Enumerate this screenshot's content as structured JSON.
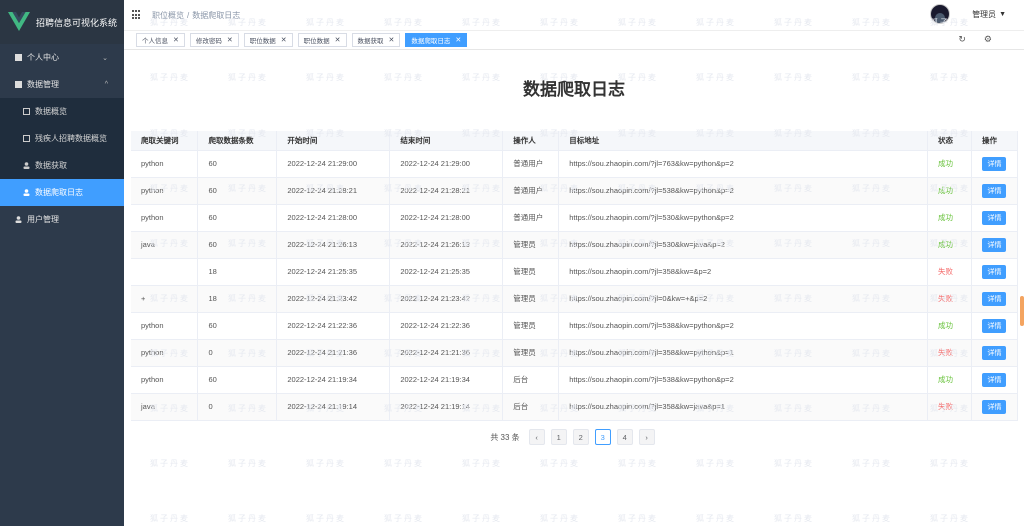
{
  "app": {
    "title": "招聘信息可视化系统"
  },
  "sidebar": {
    "items": [
      {
        "label": "个人中心",
        "icon": "square-icon"
      },
      {
        "label": "数据管理",
        "icon": "square-icon"
      }
    ],
    "sub_items": [
      {
        "label": "数据概览",
        "icon": "doc-icon"
      },
      {
        "label": "残疾人招聘数据概览",
        "icon": "doc-icon"
      },
      {
        "label": "数据获取",
        "icon": "user-icon"
      },
      {
        "label": "数据爬取日志",
        "icon": "user-icon"
      }
    ],
    "bottom_item": {
      "label": "用户管理",
      "icon": "user-icon"
    }
  },
  "header": {
    "breadcrumb": [
      "职位概览",
      "数据爬取日志"
    ],
    "user_name": "管理员"
  },
  "tags": [
    {
      "label": "个人信息"
    },
    {
      "label": "修改密码"
    },
    {
      "label": "职位数据"
    },
    {
      "label": "职位数据"
    },
    {
      "label": "数据获取"
    },
    {
      "label": "数据爬取日志"
    }
  ],
  "page": {
    "title": "数据爬取日志"
  },
  "table": {
    "headers": [
      "爬取关键词",
      "爬取数据条数",
      "开始时间",
      "结束时间",
      "操作人",
      "目标地址",
      "状态",
      "操作"
    ],
    "detail_label": "详情",
    "rows": [
      {
        "keyword": "python",
        "count": "60",
        "start": "2022-12-24 21:29:00",
        "end": "2022-12-24 21:29:00",
        "operator": "普通用户",
        "url": "https://sou.zhaopin.com/?jl=763&kw=python&p=2",
        "status": "成功",
        "ok": true
      },
      {
        "keyword": "python",
        "count": "60",
        "start": "2022-12-24 21:28:21",
        "end": "2022-12-24 21:28:21",
        "operator": "普通用户",
        "url": "https://sou.zhaopin.com/?jl=538&kw=python&p=2",
        "status": "成功",
        "ok": true
      },
      {
        "keyword": "python",
        "count": "60",
        "start": "2022-12-24 21:28:00",
        "end": "2022-12-24 21:28:00",
        "operator": "普通用户",
        "url": "https://sou.zhaopin.com/?jl=530&kw=python&p=2",
        "status": "成功",
        "ok": true
      },
      {
        "keyword": "java",
        "count": "60",
        "start": "2022-12-24 21:26:13",
        "end": "2022-12-24 21:26:13",
        "operator": "管理员",
        "url": "https://sou.zhaopin.com/?jl=530&kw=java&p=2",
        "status": "成功",
        "ok": true
      },
      {
        "keyword": "",
        "count": "18",
        "start": "2022-12-24 21:25:35",
        "end": "2022-12-24 21:25:35",
        "operator": "管理员",
        "url": "https://sou.zhaopin.com/?jl=358&kw=&p=2",
        "status": "失败",
        "ok": false
      },
      {
        "keyword": "+",
        "count": "18",
        "start": "2022-12-24 21:23:42",
        "end": "2022-12-24 21:23:42",
        "operator": "管理员",
        "url": "https://sou.zhaopin.com/?jl=0&kw=+&p=2",
        "status": "失败",
        "ok": false
      },
      {
        "keyword": "python",
        "count": "60",
        "start": "2022-12-24 21:22:36",
        "end": "2022-12-24 21:22:36",
        "operator": "管理员",
        "url": "https://sou.zhaopin.com/?jl=538&kw=python&p=2",
        "status": "成功",
        "ok": true
      },
      {
        "keyword": "python",
        "count": "0",
        "start": "2022-12-24 21:21:36",
        "end": "2022-12-24 21:21:36",
        "operator": "管理员",
        "url": "https://sou.zhaopin.com/?jl=358&kw=python&p=1",
        "status": "失败",
        "ok": false
      },
      {
        "keyword": "python",
        "count": "60",
        "start": "2022-12-24 21:19:34",
        "end": "2022-12-24 21:19:34",
        "operator": "后台",
        "url": "https://sou.zhaopin.com/?jl=538&kw=python&p=2",
        "status": "成功",
        "ok": true
      },
      {
        "keyword": "java",
        "count": "0",
        "start": "2022-12-24 21:19:14",
        "end": "2022-12-24 21:19:14",
        "operator": "后台",
        "url": "https://sou.zhaopin.com/?jl=358&kw=java&p=1",
        "status": "失败",
        "ok": false
      }
    ]
  },
  "pagination": {
    "total": "共 33 条",
    "pages": [
      "1",
      "2",
      "3",
      "4"
    ],
    "current": "3",
    "prev": "‹",
    "next": "›"
  },
  "watermark_text": "狐子丹麦",
  "colors": {
    "accent": "#409eff",
    "success": "#67c23a",
    "fail": "#f56c6c",
    "sidebar": "#2d3a4b"
  }
}
